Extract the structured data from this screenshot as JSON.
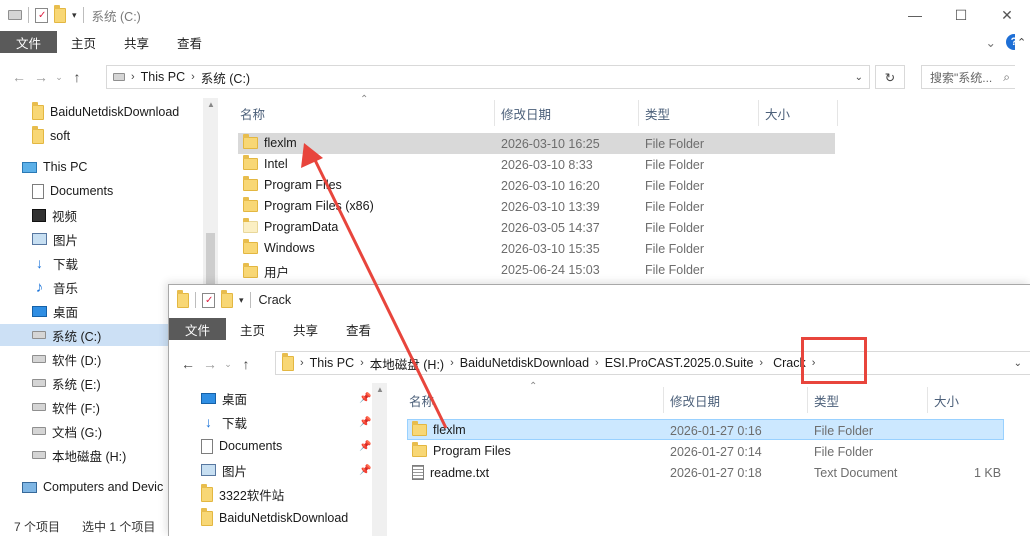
{
  "back_window": {
    "title": "系统 (C:)",
    "ribbon": {
      "file": "文件",
      "home": "主页",
      "share": "共享",
      "view": "查看"
    },
    "address": {
      "crumbs": [
        "This PC",
        "系统 (C:)"
      ]
    },
    "search_placeholder": "搜索\"系统...",
    "sidebar": [
      {
        "label": "BaiduNetdiskDownload",
        "icon": "folder-icon"
      },
      {
        "label": "soft",
        "icon": "folder-icon"
      },
      {
        "label": "This PC",
        "icon": "pc-icon"
      },
      {
        "label": "Documents",
        "icon": "document-icon"
      },
      {
        "label": "视频",
        "icon": "video-icon"
      },
      {
        "label": "图片",
        "icon": "picture-icon"
      },
      {
        "label": "下载",
        "icon": "download-icon"
      },
      {
        "label": "音乐",
        "icon": "music-icon"
      },
      {
        "label": "桌面",
        "icon": "desktop-icon"
      },
      {
        "label": "系统 (C:)",
        "icon": "drive-icon"
      },
      {
        "label": "软件 (D:)",
        "icon": "drive-icon"
      },
      {
        "label": "系统 (E:)",
        "icon": "drive-icon"
      },
      {
        "label": "软件 (F:)",
        "icon": "drive-icon"
      },
      {
        "label": "文档 (G:)",
        "icon": "drive-icon"
      },
      {
        "label": "本地磁盘 (H:)",
        "icon": "drive-icon"
      },
      {
        "label": "Computers and Devic",
        "icon": "network-icon"
      }
    ],
    "columns": {
      "name": "名称",
      "date": "修改日期",
      "type": "类型",
      "size": "大小"
    },
    "files": [
      {
        "name": "flexlm",
        "date": "2026-03-10 16:25",
        "type": "File Folder"
      },
      {
        "name": "Intel",
        "date": "2026-03-10 8:33",
        "type": "File Folder"
      },
      {
        "name": "Program Files",
        "date": "2026-03-10 16:20",
        "type": "File Folder"
      },
      {
        "name": "Program Files (x86)",
        "date": "2026-03-10 13:39",
        "type": "File Folder"
      },
      {
        "name": "ProgramData",
        "date": "2026-03-05 14:37",
        "type": "File Folder"
      },
      {
        "name": "Windows",
        "date": "2026-03-10 15:35",
        "type": "File Folder"
      },
      {
        "name": "用户",
        "date": "2025-06-24 15:03",
        "type": "File Folder"
      }
    ],
    "status": {
      "count": "7 个项目",
      "selected": "选中 1 个项目"
    }
  },
  "front_window": {
    "title": "Crack",
    "ribbon": {
      "file": "文件",
      "home": "主页",
      "share": "共享",
      "view": "查看"
    },
    "address": {
      "crumbs": [
        "This PC",
        "本地磁盘 (H:)",
        "BaiduNetdiskDownload",
        "ESI.ProCAST.2025.0.Suite",
        "Crack"
      ]
    },
    "sidebar": [
      {
        "label": "桌面",
        "icon": "desktop-icon"
      },
      {
        "label": "下载",
        "icon": "download-icon"
      },
      {
        "label": "Documents",
        "icon": "document-icon"
      },
      {
        "label": "图片",
        "icon": "picture-icon"
      },
      {
        "label": "3322软件站",
        "icon": "folder-icon"
      },
      {
        "label": "BaiduNetdiskDownload",
        "icon": "folder-icon"
      }
    ],
    "columns": {
      "name": "名称",
      "date": "修改日期",
      "type": "类型",
      "size": "大小"
    },
    "files": [
      {
        "name": "flexlm",
        "date": "2026-01-27 0:16",
        "type": "File Folder",
        "size": ""
      },
      {
        "name": "Program Files",
        "date": "2026-01-27 0:14",
        "type": "File Folder",
        "size": ""
      },
      {
        "name": "readme.txt",
        "date": "2026-01-27 0:18",
        "type": "Text Document",
        "size": "1 KB"
      }
    ]
  },
  "annotation": {
    "arrow_color": "#e8453c",
    "highlight_color": "#e8453c"
  }
}
